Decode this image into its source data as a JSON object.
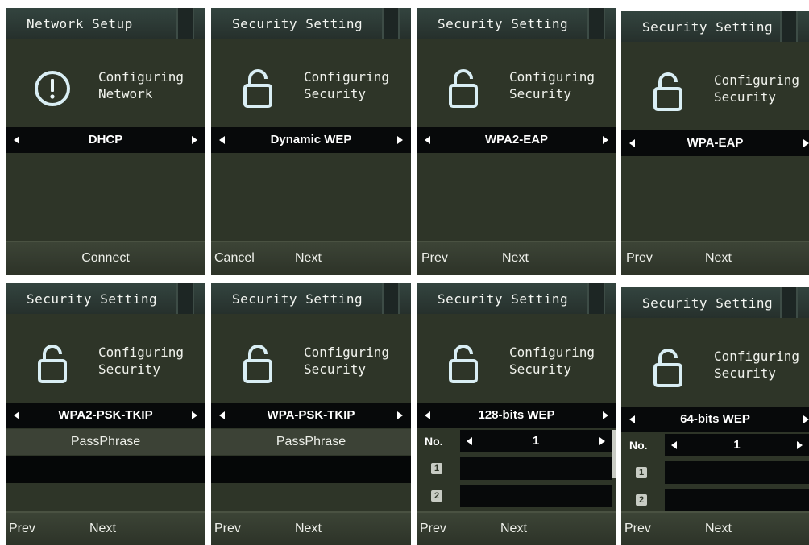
{
  "panels": [
    {
      "title": "Network Setup",
      "icon": "alert-icon",
      "config_line1": "Configuring",
      "config_line2": "Network",
      "selector_value": "DHCP",
      "softkeys": {
        "left": "",
        "center": "Connect",
        "right": ""
      }
    },
    {
      "title": "Security Setting",
      "icon": "unlock-icon",
      "config_line1": "Configuring",
      "config_line2": "Security",
      "selector_value": "Dynamic WEP",
      "softkeys": {
        "left": "Cancel",
        "center": "",
        "right": "Next"
      }
    },
    {
      "title": "Security Setting",
      "icon": "unlock-icon",
      "config_line1": "Configuring",
      "config_line2": "Security",
      "selector_value": "WPA2-EAP",
      "softkeys": {
        "left": "Prev",
        "center": "",
        "right": "Next"
      }
    },
    {
      "title": "Security Setting",
      "icon": "unlock-icon",
      "config_line1": "Configuring",
      "config_line2": "Security",
      "selector_value": "WPA-EAP",
      "softkeys": {
        "left": "Prev",
        "center": "",
        "right": "Next"
      }
    },
    {
      "title": "Security Setting",
      "icon": "unlock-icon",
      "config_line1": "Configuring",
      "config_line2": "Security",
      "selector_value": "WPA2-PSK-TKIP",
      "passphrase_label": "PassPhrase",
      "softkeys": {
        "left": "Prev",
        "center": "",
        "right": "Next"
      }
    },
    {
      "title": "Security Setting",
      "icon": "unlock-icon",
      "config_line1": "Configuring",
      "config_line2": "Security",
      "selector_value": "WPA-PSK-TKIP",
      "passphrase_label": "PassPhrase",
      "softkeys": {
        "left": "Prev",
        "center": "",
        "right": "Next"
      }
    },
    {
      "title": "Security Setting",
      "icon": "unlock-icon",
      "config_line1": "Configuring",
      "config_line2": "Security",
      "selector_value": "128-bits WEP",
      "key_no_label": "No.",
      "key_no_value": "1",
      "key_slots": [
        "1",
        "2"
      ],
      "softkeys": {
        "left": "Prev",
        "center": "",
        "right": "Next"
      }
    },
    {
      "title": "Security Setting",
      "icon": "unlock-icon",
      "config_line1": "Configuring",
      "config_line2": "Security",
      "selector_value": "64-bits WEP",
      "key_no_label": "No.",
      "key_no_value": "1",
      "key_slots": [
        "1",
        "2"
      ],
      "softkeys": {
        "left": "Prev",
        "center": "",
        "right": "Next"
      }
    }
  ],
  "colors": {
    "screen_bg": "#2e3528",
    "titlebar": "#2b3833",
    "selector_bg": "#07090a",
    "softkey_bar": "#363d31"
  }
}
